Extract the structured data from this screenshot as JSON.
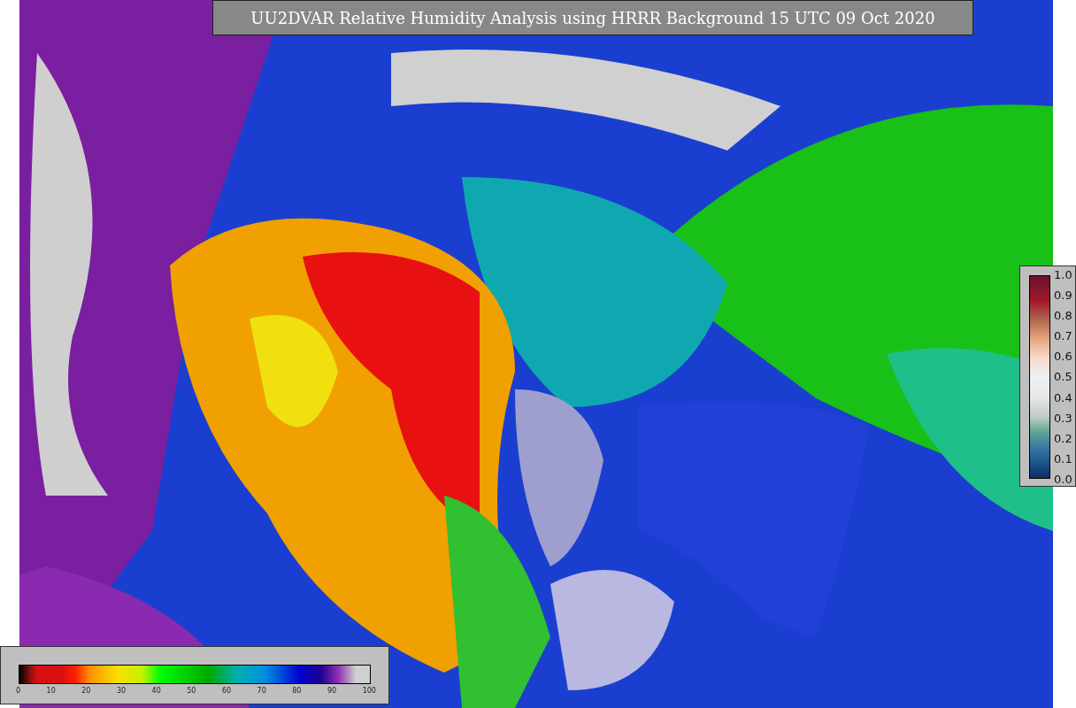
{
  "title": "UU2DVAR Relative Humidity Analysis using HRRR Background 15 UTC 09 Oct 2020",
  "humidity_colorbar": {
    "ticks": [
      "0",
      "10",
      "20",
      "30",
      "40",
      "50",
      "60",
      "70",
      "80",
      "90",
      "100"
    ]
  },
  "station_colorbar": {
    "ticks": [
      "1.0",
      "0.9",
      "0.8",
      "0.7",
      "0.6",
      "0.5",
      "0.4",
      "0.3",
      "0.2",
      "0.1",
      "0.0"
    ]
  }
}
